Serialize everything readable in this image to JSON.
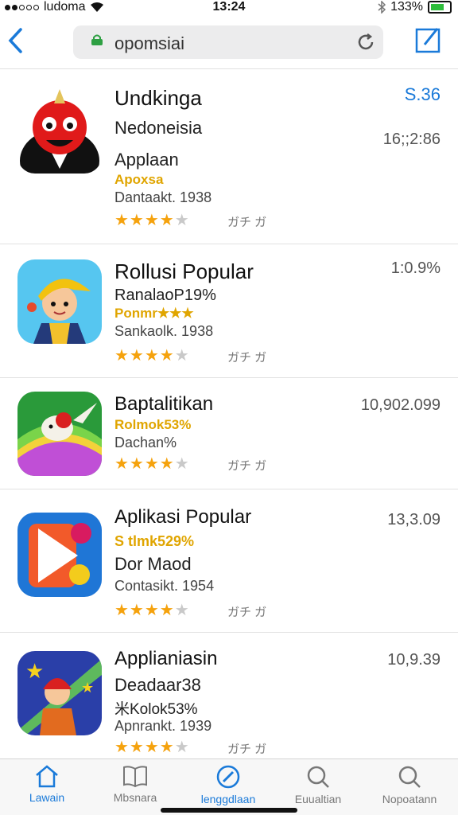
{
  "status": {
    "carrier": "ludoma",
    "time": "13:24",
    "battery": "133%"
  },
  "nav": {
    "url": "opomsiai"
  },
  "apps": [
    {
      "title": "Undkinga",
      "subtitle": "Nedoneisia",
      "category": "Applaan",
      "note": "Apoxsa",
      "meta": "Dantaakt. 1938",
      "tag": "ガチ ガ",
      "price": "S.36",
      "price2": "16;;2:86",
      "rating": 4
    },
    {
      "title": "Rollusi Popular",
      "subtitle": "RanalaoP19%",
      "note": "Ponmr★★★",
      "meta": "Sankaolk. 1938",
      "tag": "ガチ ガ",
      "price": "1:0.9%",
      "rating": 4
    },
    {
      "title": "Baptalitikan",
      "subtitle": "Rolmok53%",
      "meta": "Dachan%",
      "tag": "ガチ ガ",
      "price": "10,902.099",
      "rating": 4
    },
    {
      "title": "Aplikasi Popular",
      "subtitle": "S tlmk529%",
      "category": "Dor Maod",
      "meta": "Contasikt. 1954",
      "tag": "ガチ ガ",
      "price": "13,3.09",
      "rating": 4
    },
    {
      "title": "Applianiasin",
      "subtitle": "Deadaar38",
      "note": "米Kolok53%",
      "meta": "Apnrankt. 1939",
      "tag": "ガチ ガ",
      "price": "10,9.39",
      "rating": 4
    }
  ],
  "tabs": [
    {
      "label": "Lawain",
      "icon": "home-icon",
      "active": true
    },
    {
      "label": "Mbsnara",
      "icon": "book-icon"
    },
    {
      "label": "lenggdlaan",
      "icon": "compass-icon",
      "active": true
    },
    {
      "label": "Euualtian",
      "icon": "search-icon"
    },
    {
      "label": "Nopoatann",
      "icon": "search-icon"
    }
  ],
  "colors": {
    "accent": "#1a7ad9",
    "star": "#f5a20d",
    "note": "#e0a500"
  }
}
